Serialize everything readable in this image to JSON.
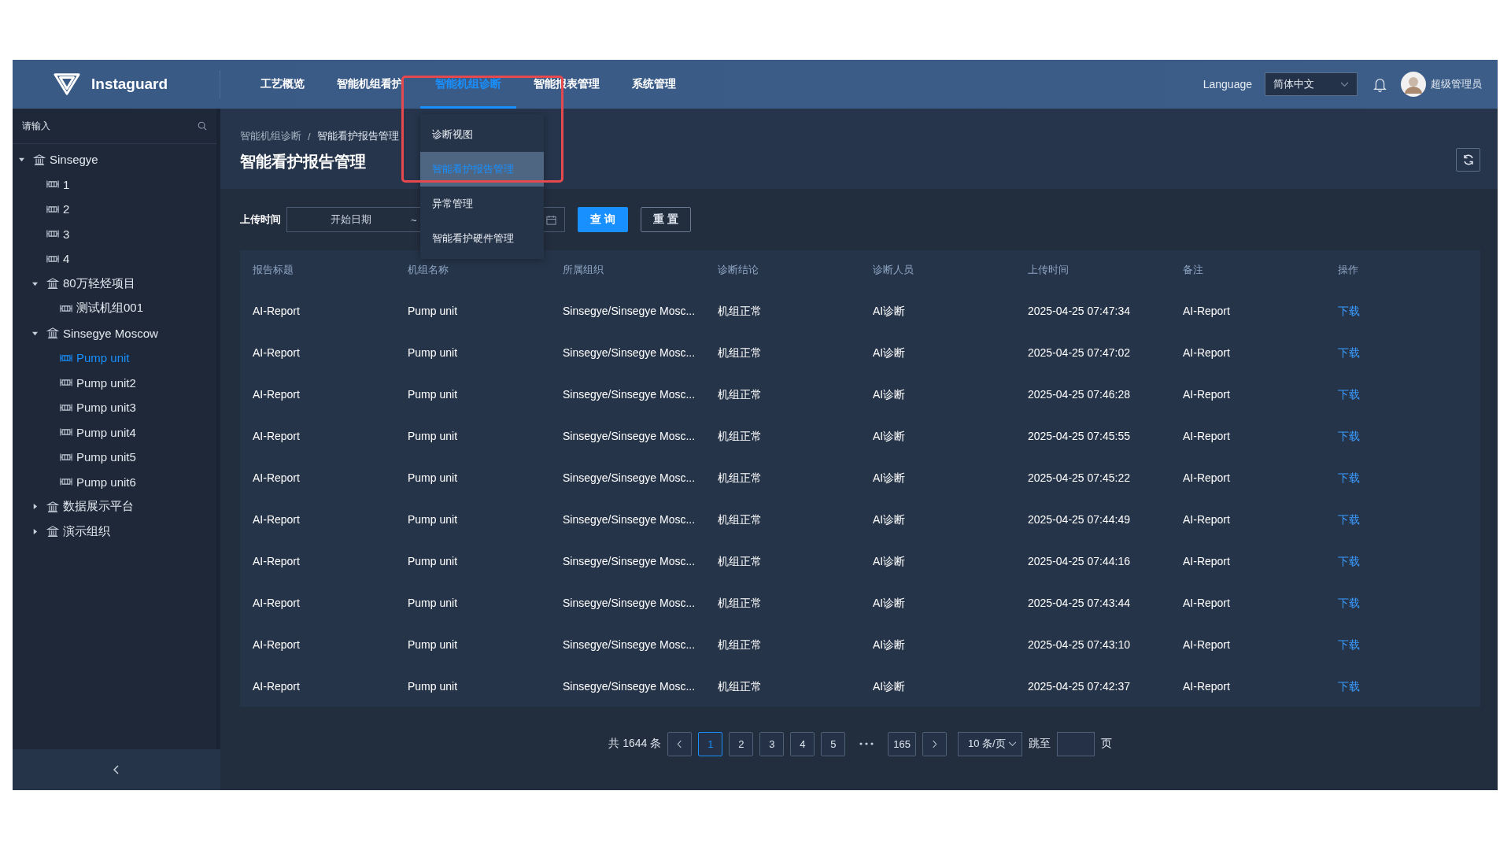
{
  "header": {
    "brand": "Instaguard",
    "nav": [
      {
        "label": "工艺概览",
        "selected": false
      },
      {
        "label": "智能机组看护",
        "selected": false
      },
      {
        "label": "智能机组诊断",
        "selected": true
      },
      {
        "label": "智能报表管理",
        "selected": false
      },
      {
        "label": "系统管理",
        "selected": false
      }
    ],
    "language_label": "Language",
    "language_select": "简体中文",
    "user_name": "超级管理员"
  },
  "nav_dropdown": {
    "items": [
      {
        "label": "诊断视图",
        "selected": false
      },
      {
        "label": "智能看护报告管理",
        "selected": true
      },
      {
        "label": "异常管理",
        "selected": false
      },
      {
        "label": "智能看护硬件管理",
        "selected": false
      }
    ]
  },
  "sidebar": {
    "search": {
      "placeholder": "请输入"
    },
    "tree": [
      {
        "label": "Sinsegye",
        "kind": "org",
        "expanded": true,
        "selected": false,
        "children": [
          {
            "label": "1",
            "kind": "device",
            "selected": false
          },
          {
            "label": "2",
            "kind": "device",
            "selected": false
          },
          {
            "label": "3",
            "kind": "device",
            "selected": false
          },
          {
            "label": "4",
            "kind": "device",
            "selected": false
          },
          {
            "label": "80万轻烃项目",
            "kind": "org",
            "expanded": true,
            "selected": false,
            "children": [
              {
                "label": "测试机组001",
                "kind": "device",
                "selected": false
              }
            ]
          },
          {
            "label": "Sinsegye Moscow",
            "kind": "org",
            "expanded": true,
            "selected": false,
            "children": [
              {
                "label": "Pump unit",
                "kind": "device",
                "selected": true
              },
              {
                "label": "Pump unit2",
                "kind": "device",
                "selected": false
              },
              {
                "label": "Pump unit3",
                "kind": "device",
                "selected": false
              },
              {
                "label": "Pump unit4",
                "kind": "device",
                "selected": false
              },
              {
                "label": "Pump unit5",
                "kind": "device",
                "selected": false
              },
              {
                "label": "Pump unit6",
                "kind": "device",
                "selected": false
              }
            ]
          },
          {
            "label": "数据展示平台",
            "kind": "org",
            "expanded": false,
            "selected": false
          },
          {
            "label": "演示组织",
            "kind": "org",
            "expanded": false,
            "selected": false
          }
        ]
      }
    ]
  },
  "breadcrumb": {
    "items": [
      "智能机组诊断",
      "智能看护报告管理"
    ],
    "separator": "/"
  },
  "page_title": "智能看护报告管理",
  "filter": {
    "label": "上传时间",
    "start_placeholder": "开始日期",
    "range_separator": "~",
    "buttons": [
      {
        "label": "查 询",
        "kind": "primary"
      },
      {
        "label": "重 置",
        "kind": "default"
      }
    ]
  },
  "table": {
    "columns": [
      {
        "label": "报告标题",
        "kind": "text"
      },
      {
        "label": "机组名称",
        "kind": "text"
      },
      {
        "label": "所属组织",
        "kind": "text"
      },
      {
        "label": "诊断结论",
        "kind": "text"
      },
      {
        "label": "诊断人员",
        "kind": "text"
      },
      {
        "label": "上传时间",
        "kind": "text"
      },
      {
        "label": "备注",
        "kind": "text"
      },
      {
        "label": "操作",
        "kind": "link"
      }
    ],
    "rows": [
      [
        "AI-Report",
        "Pump unit",
        "Sinsegye/Sinsegye Mosc...",
        "机组正常",
        "AI诊断",
        "2025-04-25 07:47:34",
        "AI-Report",
        "下载"
      ],
      [
        "AI-Report",
        "Pump unit",
        "Sinsegye/Sinsegye Mosc...",
        "机组正常",
        "AI诊断",
        "2025-04-25 07:47:02",
        "AI-Report",
        "下载"
      ],
      [
        "AI-Report",
        "Pump unit",
        "Sinsegye/Sinsegye Mosc...",
        "机组正常",
        "AI诊断",
        "2025-04-25 07:46:28",
        "AI-Report",
        "下载"
      ],
      [
        "AI-Report",
        "Pump unit",
        "Sinsegye/Sinsegye Mosc...",
        "机组正常",
        "AI诊断",
        "2025-04-25 07:45:55",
        "AI-Report",
        "下载"
      ],
      [
        "AI-Report",
        "Pump unit",
        "Sinsegye/Sinsegye Mosc...",
        "机组正常",
        "AI诊断",
        "2025-04-25 07:45:22",
        "AI-Report",
        "下载"
      ],
      [
        "AI-Report",
        "Pump unit",
        "Sinsegye/Sinsegye Mosc...",
        "机组正常",
        "AI诊断",
        "2025-04-25 07:44:49",
        "AI-Report",
        "下载"
      ],
      [
        "AI-Report",
        "Pump unit",
        "Sinsegye/Sinsegye Mosc...",
        "机组正常",
        "AI诊断",
        "2025-04-25 07:44:16",
        "AI-Report",
        "下载"
      ],
      [
        "AI-Report",
        "Pump unit",
        "Sinsegye/Sinsegye Mosc...",
        "机组正常",
        "AI诊断",
        "2025-04-25 07:43:44",
        "AI-Report",
        "下载"
      ],
      [
        "AI-Report",
        "Pump unit",
        "Sinsegye/Sinsegye Mosc...",
        "机组正常",
        "AI诊断",
        "2025-04-25 07:43:10",
        "AI-Report",
        "下载"
      ],
      [
        "AI-Report",
        "Pump unit",
        "Sinsegye/Sinsegye Mosc...",
        "机组正常",
        "AI诊断",
        "2025-04-25 07:42:37",
        "AI-Report",
        "下载"
      ]
    ]
  },
  "pagination": {
    "total": "共 1644 条",
    "pages": [
      {
        "kind": "page",
        "label": "1",
        "selected": true
      },
      {
        "kind": "page",
        "label": "2",
        "selected": false
      },
      {
        "kind": "page",
        "label": "3",
        "selected": false
      },
      {
        "kind": "page",
        "label": "4",
        "selected": false
      },
      {
        "kind": "page",
        "label": "5",
        "selected": false
      },
      {
        "kind": "ellipsis"
      },
      {
        "kind": "page",
        "label": "165",
        "selected": false
      }
    ],
    "page_size": "10 条/页",
    "jump_label": "跳至",
    "jump_suffix": "页"
  }
}
